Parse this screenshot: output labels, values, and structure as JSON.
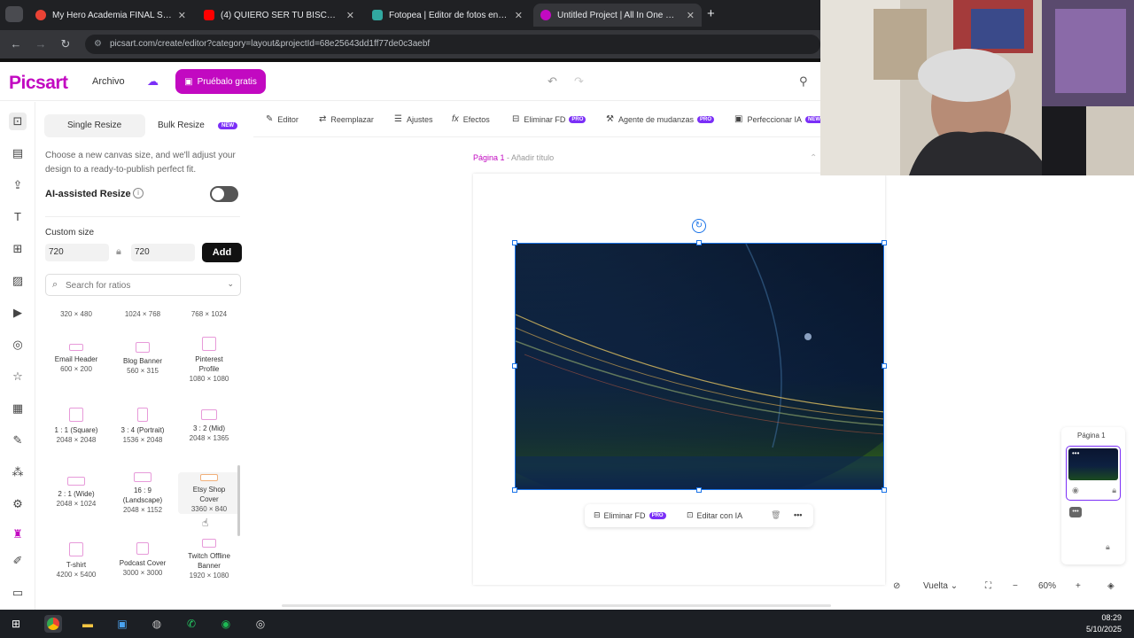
{
  "browser": {
    "tabs": [
      {
        "title": "My Hero Academia FINAL SEAS",
        "color": "#ea4335",
        "active": false
      },
      {
        "title": "(4) QUIERO SER TU BISCOCHITO",
        "color": "#ff0000",
        "active": false
      },
      {
        "title": "Fotopea | Editor de fotos en línea",
        "color": "#31a8a0",
        "active": false
      },
      {
        "title": "Untitled Project | All In One Web",
        "color": "#c209c1",
        "active": true
      }
    ],
    "new_tab": "+",
    "url": "picsart.com/create/editor?category=layout&projectId=68e25643dd1ff77de0c3aebf"
  },
  "app": {
    "logo": "Picsart",
    "menu_archivo": "Archivo",
    "try_button": "Pruébalo gratis",
    "brand_color": "#c209c1",
    "pro_color": "#7b2ff7"
  },
  "panel": {
    "tab_single": "Single Resize",
    "tab_bulk": "Bulk Resize",
    "new_badge": "NEW",
    "description": "Choose a new canvas size, and we'll adjust your design to a ready-to-publish perfect fit.",
    "ai_label": "AI-assisted Resize",
    "ai_toggle": "off",
    "custom_size_label": "Custom size",
    "width_value": "720",
    "height_value": "720",
    "add_button": "Add",
    "search_placeholder": "Search for ratios",
    "top_dims": [
      "320 × 480",
      "1024 × 768",
      "768 × 1024"
    ],
    "presets": [
      {
        "name": "Email Header",
        "dims": "600 × 200"
      },
      {
        "name": "Blog Banner",
        "dims": "560 × 315"
      },
      {
        "name": "Pinterest Profile",
        "dims": "1080 × 1080"
      },
      {
        "name": "1 : 1 (Square)",
        "dims": "2048 × 2048"
      },
      {
        "name": "3 : 4 (Portrait)",
        "dims": "1536 × 2048"
      },
      {
        "name": "3 : 2 (Mid)",
        "dims": "2048 × 1365"
      },
      {
        "name": "2 : 1 (Wide)",
        "dims": "2048 × 1024"
      },
      {
        "name": "16 : 9 (Landscape)",
        "dims": "2048 × 1152"
      },
      {
        "name": "Etsy Shop Cover",
        "dims": "3360 × 840"
      },
      {
        "name": "T-shirt",
        "dims": "4200 × 5400"
      },
      {
        "name": "Podcast Cover",
        "dims": "3000 × 3000"
      },
      {
        "name": "Twitch Offline Banner",
        "dims": "1920 × 1080"
      }
    ]
  },
  "toolbar": {
    "editor": "Editor",
    "reemplazar": "Reemplazar",
    "ajustes": "Ajustes",
    "efectos": "Efectos",
    "eliminar_fd": "Eliminar FD",
    "agente": "Agente de mudanzas",
    "perfeccionar": "Perfeccionar IA",
    "pro_badge": "PRO",
    "new_badge": "NEW"
  },
  "canvas": {
    "page_label": "Página 1",
    "page_separator": " - ",
    "add_title": "Añadir título",
    "ctx_eliminar": "Eliminar FD",
    "ctx_editar": "Editar con IA"
  },
  "pages_panel": {
    "title": "Página 1"
  },
  "bottom": {
    "view": "Vuelta",
    "zoom": "60%"
  },
  "taskbar": {
    "time": "08:29",
    "date": "5/10/2025"
  }
}
